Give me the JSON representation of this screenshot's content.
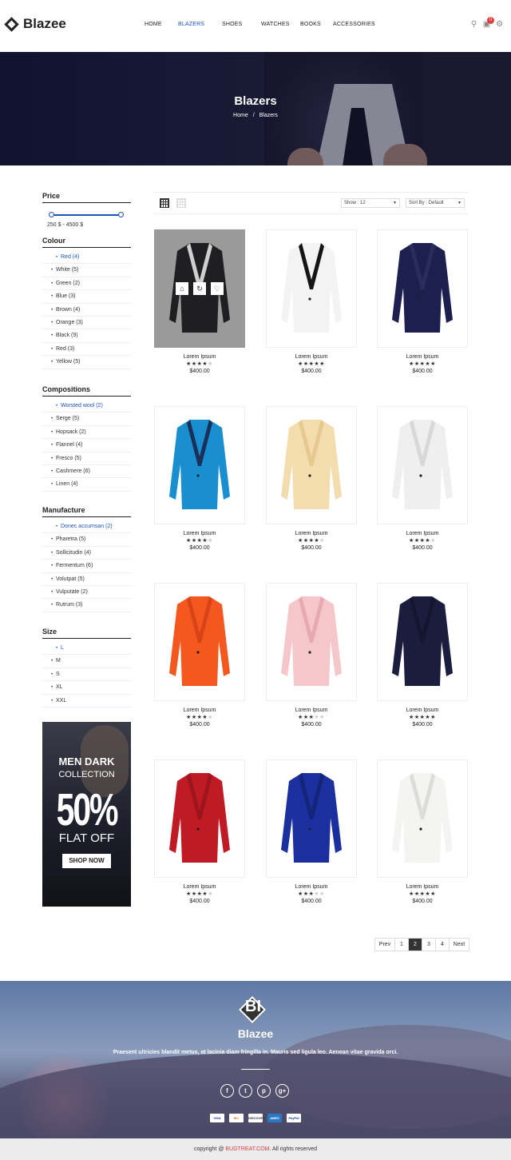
{
  "header": {
    "logo_text": "Blazee",
    "nav": [
      "HOME",
      "BLAZERS",
      "SHOES",
      "WATCHES",
      "BOOKS",
      "ACCESSORIES"
    ],
    "cart_count": "0"
  },
  "banner": {
    "title": "Blazers",
    "breadcrumb_home": "Home",
    "breadcrumb_sep": "/",
    "breadcrumb_current": "Blazers"
  },
  "sidebar": {
    "price": {
      "heading": "Price",
      "range": "250 $ - 4500 $"
    },
    "colour": {
      "heading": "Colour",
      "items": [
        "Red (4)",
        "White (5)",
        "Green (2)",
        "Blue (3)",
        "Brown (4)",
        "Orange (3)",
        "Black (9)",
        "Red (3)",
        "Yellow (5)"
      ]
    },
    "compositions": {
      "heading": "Compositions",
      "items": [
        "Worsted wool (2)",
        "Serge (5)",
        "Hopsack (2)",
        "Flannel (4)",
        "Fresco (5)",
        "Cashmere (6)",
        "Linen (4)"
      ]
    },
    "manufacture": {
      "heading": "Manufacture",
      "items": [
        "Donec accumsan (2)",
        "Pharetra (5)",
        "Sollicitudin (4)",
        "Fermentum (6)",
        "Volutpat (5)",
        "Vulputate (2)",
        "Rutrum (3)"
      ]
    },
    "size": {
      "heading": "Size",
      "items": [
        "L",
        "M",
        "S",
        "XL",
        "XXL"
      ]
    }
  },
  "promo": {
    "line1": "MEN DARK",
    "line2": "COLLECTION",
    "line3": "50%",
    "line4": "FLAT OFF",
    "button": "SHOP NOW"
  },
  "toolbar": {
    "show": "Show : 12",
    "sort": "Sort By : Default"
  },
  "products": [
    {
      "name": "Lorem Ipsum",
      "price": "$400.00",
      "rating": 4,
      "color": "#1f1f22",
      "collar": "#cfcfcf",
      "hover": true
    },
    {
      "name": "Lorem Ipsum",
      "price": "$400.00",
      "rating": 5,
      "color": "#f3f3f3",
      "collar": "#151515"
    },
    {
      "name": "Lorem Ipsum",
      "price": "$400.00",
      "rating": 5,
      "color": "#1d1f4e",
      "collar": "#2a2c5e"
    },
    {
      "name": "Lorem Ipsum",
      "price": "$400.00",
      "rating": 4,
      "color": "#1a8fd0",
      "collar": "#1a2f5a"
    },
    {
      "name": "Lorem Ipsum",
      "price": "$400.00",
      "rating": 4,
      "color": "#f3dcae",
      "collar": "#e6c98f"
    },
    {
      "name": "Lorem Ipsum",
      "price": "$400.00",
      "rating": 4,
      "color": "#efefef",
      "collar": "#d8d8d8"
    },
    {
      "name": "Lorem Ipsum",
      "price": "$400.00",
      "rating": 4,
      "color": "#f4581e",
      "collar": "#d8431a"
    },
    {
      "name": "Lorem Ipsum",
      "price": "$400.00",
      "rating": 3,
      "color": "#f5c7cb",
      "collar": "#e6aab0"
    },
    {
      "name": "Lorem Ipsum",
      "price": "$400.00",
      "rating": 5,
      "color": "#1b1d3f",
      "collar": "#14162f"
    },
    {
      "name": "Lorem Ipsum",
      "price": "$400.00",
      "rating": 4,
      "color": "#c01b25",
      "collar": "#9c141c"
    },
    {
      "name": "Lorem Ipsum",
      "price": "$400.00",
      "rating": 3,
      "color": "#1c2f9e",
      "collar": "#142478"
    },
    {
      "name": "Lorem Ipsum",
      "price": "$400.00",
      "rating": 5,
      "color": "#f4f4f2",
      "collar": "#dcdcd8"
    }
  ],
  "pagination": [
    "Prev",
    "1",
    "2",
    "3",
    "4",
    "Next"
  ],
  "pagination_current": "2",
  "footer": {
    "mark": "BI",
    "name": "Blazee",
    "description": "Praesent ultricies blandit metus, at lacinia diam fringilla in. Mauris sed ligula leo. Aenean vitae gravida orci.",
    "social": [
      "f",
      "t",
      "p",
      "g+"
    ],
    "payments": [
      "VISA",
      "MC",
      "DISCOVER",
      "AMEX",
      "PayPal"
    ],
    "copyright_prefix": "copyright @ ",
    "copyright_brand": "BUGTREAT.COM",
    "copyright_suffix": ". All rights reserved"
  }
}
